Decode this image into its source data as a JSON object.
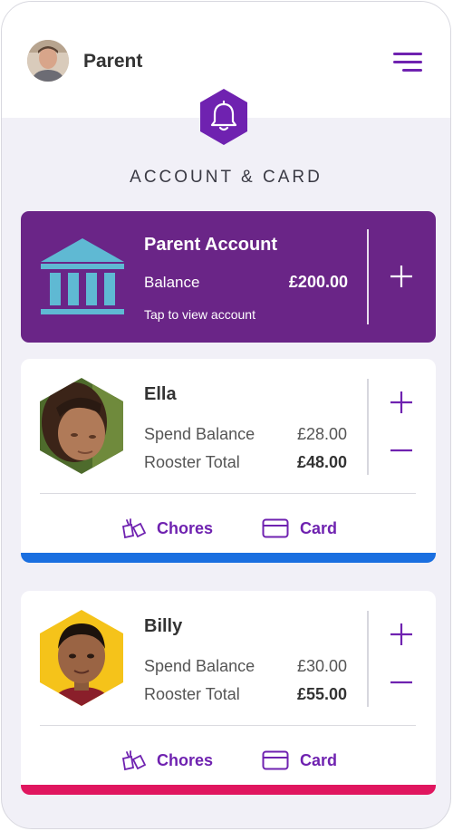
{
  "header": {
    "user_name": "Parent",
    "avatar": "parent-avatar",
    "menu_icon": "hamburger-menu-icon",
    "bell_icon": "bell-icon"
  },
  "section_title": "ACCOUNT & CARD",
  "parent_account": {
    "title": "Parent Account",
    "balance_label": "Balance",
    "balance_value": "£200.00",
    "hint": "Tap to view account",
    "icon": "bank-icon",
    "add_icon": "plus-icon"
  },
  "children": [
    {
      "name": "Ella",
      "spend_label": "Spend Balance",
      "spend_value": "£28.00",
      "rooster_label": "Rooster Total",
      "rooster_value": "£48.00",
      "chores_label": "Chores",
      "card_label": "Card",
      "accent_color": "#1a6fe0"
    },
    {
      "name": "Billy",
      "spend_label": "Spend Balance",
      "spend_value": "£30.00",
      "rooster_label": "Rooster Total",
      "rooster_value": "£55.00",
      "chores_label": "Chores",
      "card_label": "Card",
      "accent_color": "#e0165f"
    }
  ],
  "colors": {
    "brand_purple": "#6f22b0",
    "account_card_bg": "#6a2587",
    "bank_icon": "#5fb9d3"
  }
}
